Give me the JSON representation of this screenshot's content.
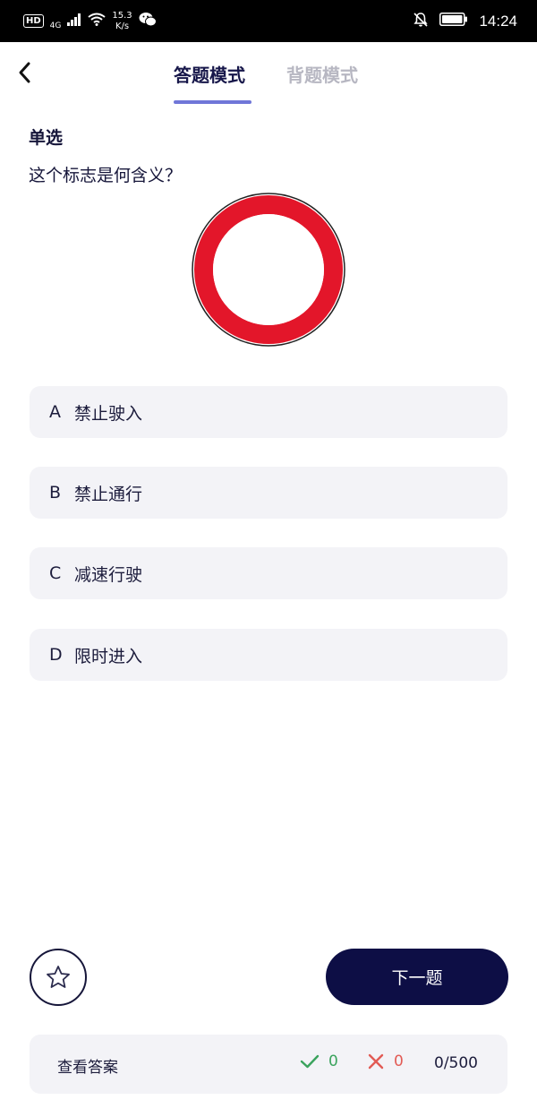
{
  "status_bar": {
    "hd": "HD",
    "network": "4G",
    "speed_value": "15.3",
    "speed_unit": "K/s",
    "time": "14:24"
  },
  "header": {
    "tabs": [
      {
        "label": "答题模式",
        "active": true
      },
      {
        "label": "背题模式",
        "active": false
      }
    ]
  },
  "question": {
    "type": "单选",
    "text": "这个标志是何含义？",
    "image": "no-vehicles-sign"
  },
  "options": [
    {
      "letter": "A",
      "text": "禁止驶入"
    },
    {
      "letter": "B",
      "text": "禁止通行"
    },
    {
      "letter": "C",
      "text": "减速行驶"
    },
    {
      "letter": "D",
      "text": "限时进入"
    }
  ],
  "actions": {
    "next_label": "下一题",
    "favorite_icon": "star-icon"
  },
  "footer": {
    "view_answer": "查看答案",
    "correct_count": "0",
    "wrong_count": "0",
    "progress": "0/500"
  },
  "colors": {
    "accent": "#7076d8",
    "primary": "#0d0e45",
    "correct": "#3aa35d",
    "wrong": "#e25b55",
    "sign_red": "#e3162a"
  }
}
